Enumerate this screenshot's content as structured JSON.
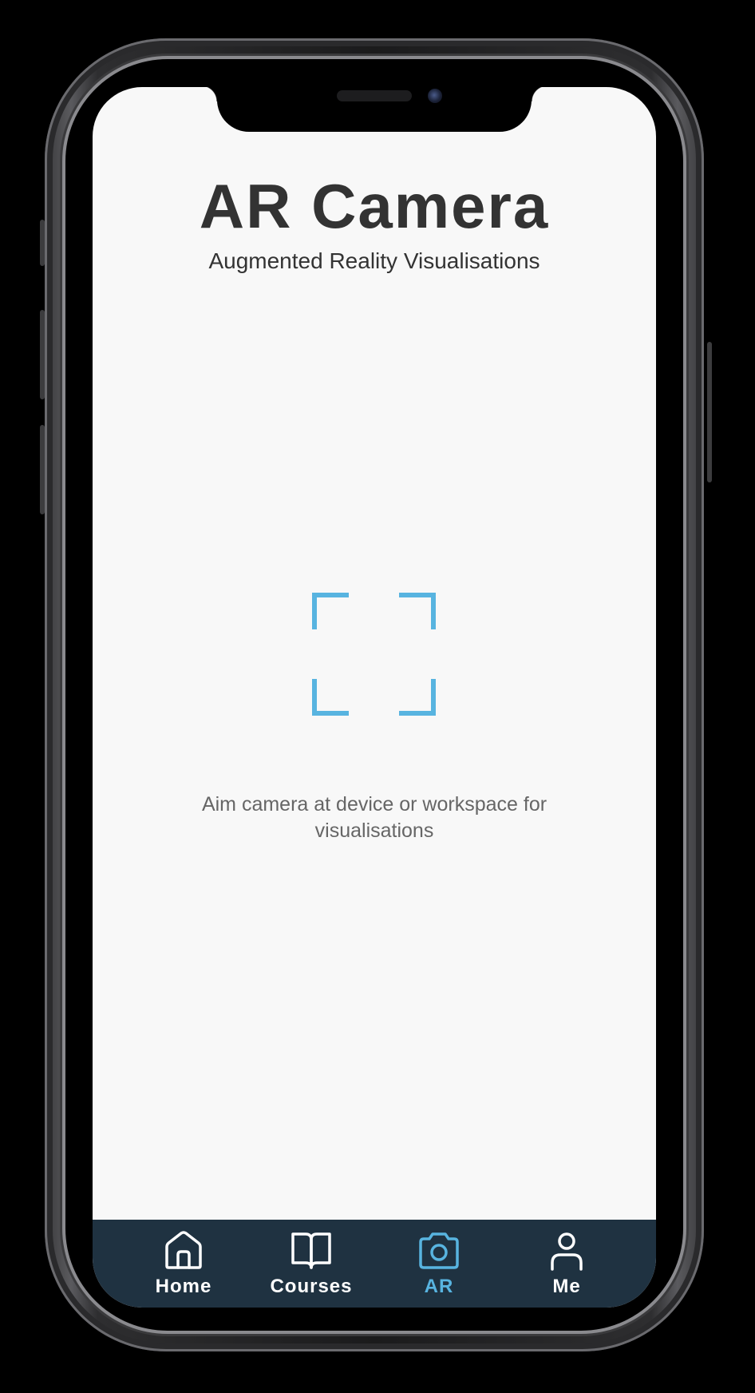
{
  "header": {
    "title": "AR Camera",
    "subtitle": "Augmented Reality Visualisations"
  },
  "scanner": {
    "icon": "scan-frame-icon",
    "hint": "Aim camera at device or workspace for visualisations"
  },
  "tabbar": {
    "items": [
      {
        "label": "Home",
        "icon": "home-icon",
        "active": false
      },
      {
        "label": "Courses",
        "icon": "book-icon",
        "active": false
      },
      {
        "label": "AR",
        "icon": "camera-icon",
        "active": true
      },
      {
        "label": "Me",
        "icon": "user-icon",
        "active": false
      }
    ]
  },
  "colors": {
    "accent": "#58b4e0",
    "tabbar_bg": "#1f3241",
    "screen_bg": "#f8f8f8",
    "title_text": "#333333",
    "hint_text": "#666666"
  }
}
